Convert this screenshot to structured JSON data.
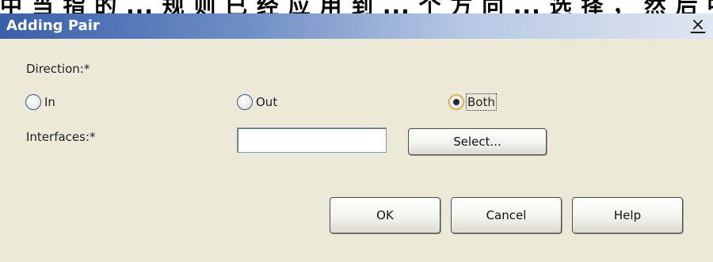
{
  "background_text": "中 当 指 的 ... 规 则 已 经 应 用 到 ... 个 方 向 ... 选 择 ， 然 后 中 当 选",
  "dialog": {
    "title": "Adding Pair",
    "close_glyph": "×"
  },
  "direction": {
    "label": "Direction:*",
    "options": [
      {
        "label": "In",
        "checked": false
      },
      {
        "label": "Out",
        "checked": false
      },
      {
        "label": "Both",
        "checked": true
      }
    ]
  },
  "interfaces": {
    "label": "Interfaces:*",
    "value": "",
    "placeholder": "",
    "select_label": "Select..."
  },
  "buttons": {
    "ok_label": "OK",
    "cancel_label": "Cancel",
    "help_label": "Help"
  }
}
